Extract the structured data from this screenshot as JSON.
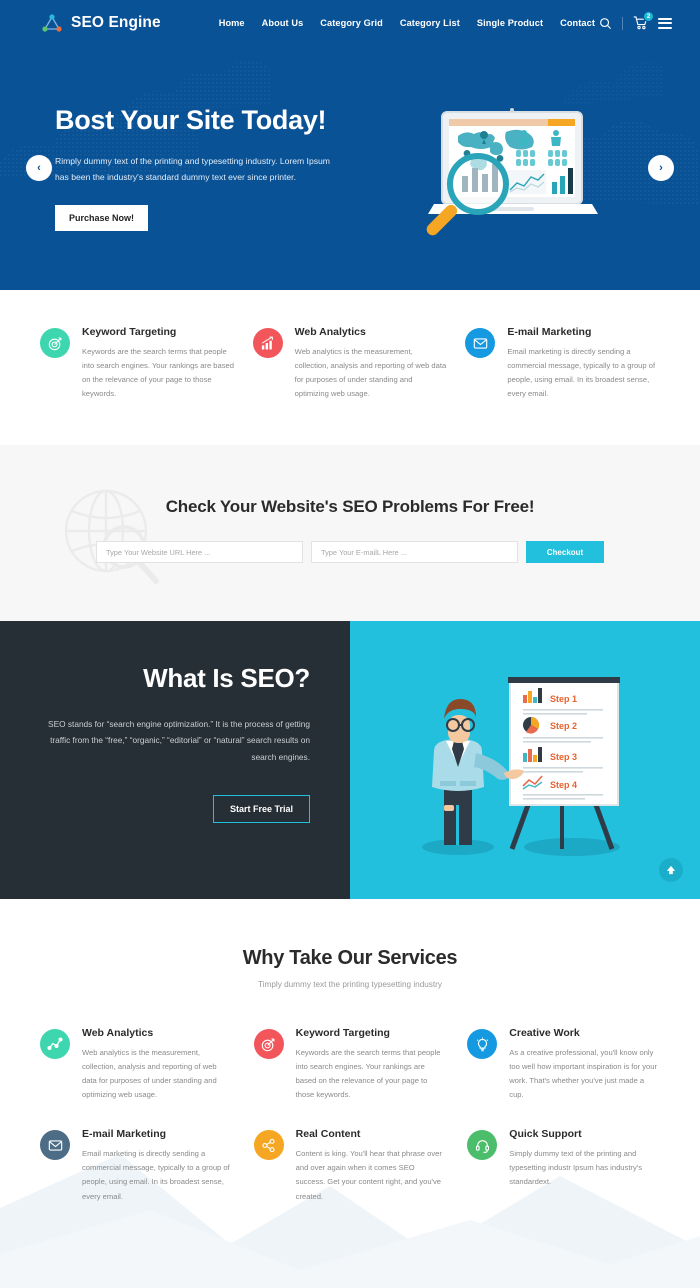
{
  "header": {
    "logo_text": "SEO Engine",
    "logo_icon": "network-nodes-icon",
    "nav": [
      {
        "label": "Home"
      },
      {
        "label": "About Us"
      },
      {
        "label": "Category Grid"
      },
      {
        "label": "Category List"
      },
      {
        "label": "Single Product"
      },
      {
        "label": "Contact"
      }
    ],
    "search_icon": "search-icon",
    "cart_icon": "cart-icon",
    "cart_count": "2",
    "menu_icon": "hamburger-menu-icon",
    "bg_color": "#0a5296"
  },
  "hero": {
    "title": "Bost Your Site Today!",
    "subtitle": "Rimply dummy text of the printing and typesetting industry. Lorem Ipsum has been the industry's standard dummy text ever since printer.",
    "button_label": "Purchase Now!",
    "prev_icon": "chevron-left-icon",
    "next_icon": "chevron-right-icon",
    "illustration": "laptop-analytics-magnifier-illustration",
    "bg_color": "#0a5296"
  },
  "features": [
    {
      "icon": "target-icon",
      "icon_color": "#3dd6ae",
      "title": "Keyword Targeting",
      "text": "Keywords are the search terms that people into search engines. Your rankings are based on the relevance of your page to those keywords."
    },
    {
      "icon": "bar-chart-icon",
      "icon_color": "#f2565b",
      "title": "Web Analytics",
      "text": "Web analytics is the measurement, collection, analysis and reporting of web data for purposes of under standing and optimizing web usage."
    },
    {
      "icon": "envelope-icon",
      "icon_color": "#159ae2",
      "title": "E-mail Marketing",
      "text": "Email marketing is directly sending a commercial message, typically to a group of people, using email. In its broadest sense, every email."
    }
  ],
  "seocheck": {
    "title": "Check Your Website's SEO Problems For Free!",
    "url_placeholder": "Type Your Website URL Here ...",
    "url_value": "",
    "email_placeholder": "Type Your E-mailL Here ...",
    "email_value": "",
    "button_label": "Checkout",
    "button_color": "#23c0dd",
    "bg_icon": "globe-magnifier-icon",
    "bg_color": "#f7f7f7"
  },
  "whatis": {
    "title": "What Is SEO?",
    "text": "SEO stands for “search engine optimization.” It is the process of getting traffic from the “free,” “organic,” “editorial” or “natural” search results on search engines.",
    "button_label": "Start Free Trial",
    "left_bg": "#272f36",
    "right_bg": "#23c0dd",
    "illustration": "presenter-flipchart-illustration",
    "chart_steps": [
      "Step 1",
      "Step 2",
      "Step 3",
      "Step 4"
    ],
    "scroll_top_icon": "arrow-up-icon"
  },
  "services": {
    "title": "Why Take Our Services",
    "subtitle": "Timply dummy text the printing typesetting industry",
    "items": [
      {
        "icon": "analytics-line-icon",
        "icon_color": "#3dd6ae",
        "title": "Web Analytics",
        "text": "Web analytics is the measurement, collection, analysis and reporting of web data for purposes of under standing and optimizing web usage."
      },
      {
        "icon": "target-icon",
        "icon_color": "#f2565b",
        "title": "Keyword Targeting",
        "text": "Keywords are the search terms that people into search engines. Your rankings are based on the relevance of your page to those keywords."
      },
      {
        "icon": "lightbulb-icon",
        "icon_color": "#159ae2",
        "title": "Creative Work",
        "text": "As a creative professional, you'll know only too well how important inspiration is for your work. That's whether you've just made a cup."
      },
      {
        "icon": "envelope-icon",
        "icon_color": "#4d6d86",
        "title": "E-mail Marketing",
        "text": "Email marketing is directly sending a commercial message, typically to a group of people, using email. In its broadest sense, every email."
      },
      {
        "icon": "share-nodes-icon",
        "icon_color": "#f5a623",
        "title": "Real Content",
        "text": "Content is king. You'll hear that phrase over and over again when it comes SEO success. Get your content right, and you've created."
      },
      {
        "icon": "headset-icon",
        "icon_color": "#4cbd6a",
        "title": "Quick Support",
        "text": "Simply dummy text of the printing and typesetting industr Ipsum has industry's standardext."
      }
    ]
  }
}
